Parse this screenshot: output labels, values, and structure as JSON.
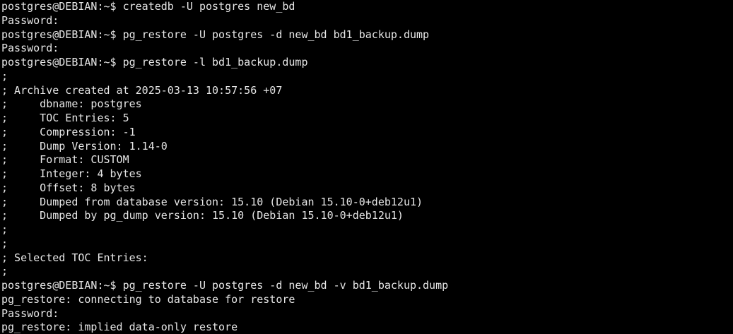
{
  "terminal": {
    "lines": [
      "postgres@DEBIAN:~$ createdb -U postgres new_bd",
      "Password:",
      "postgres@DEBIAN:~$ pg_restore -U postgres -d new_bd bd1_backup.dump",
      "Password:",
      "postgres@DEBIAN:~$ pg_restore -l bd1_backup.dump",
      ";",
      "; Archive created at 2025-03-13 10:57:56 +07",
      ";     dbname: postgres",
      ";     TOC Entries: 5",
      ";     Compression: -1",
      ";     Dump Version: 1.14-0",
      ";     Format: CUSTOM",
      ";     Integer: 4 bytes",
      ";     Offset: 8 bytes",
      ";     Dumped from database version: 15.10 (Debian 15.10-0+deb12u1)",
      ";     Dumped by pg_dump version: 15.10 (Debian 15.10-0+deb12u1)",
      ";",
      ";",
      "; Selected TOC Entries:",
      ";",
      "postgres@DEBIAN:~$ pg_restore -U postgres -d new_bd -v bd1_backup.dump",
      "pg_restore: connecting to database for restore",
      "Password:",
      "pg_restore: implied data-only restore"
    ]
  }
}
